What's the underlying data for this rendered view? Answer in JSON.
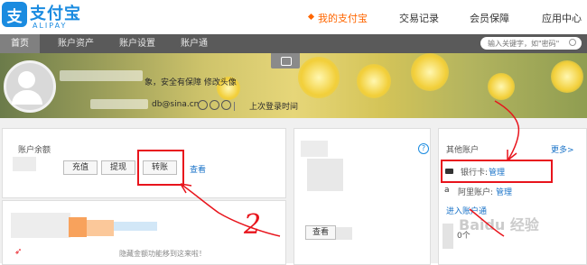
{
  "brand": {
    "logo_glyph": "支",
    "name": "支付宝",
    "sub": "ALIPAY",
    "color": "#1a8be0"
  },
  "topnav": [
    {
      "label": "我的支付宝",
      "active": true
    },
    {
      "label": "交易记录"
    },
    {
      "label": "会员保障"
    },
    {
      "label": "应用中心"
    }
  ],
  "subnav": [
    {
      "label": "首页",
      "active": true
    },
    {
      "label": "账户资产"
    },
    {
      "label": "账户设置"
    },
    {
      "label": "账户通"
    }
  ],
  "search": {
    "placeholder": "输入关键字，如\"密码\""
  },
  "profile": {
    "security_text": "象，安全有保障  修改头像",
    "email": "db@sina.cn",
    "last_login": "上次登录时间"
  },
  "balance": {
    "title": "账户余额",
    "recharge": "充值",
    "withdraw": "提现",
    "transfer": "转账",
    "view": "查看"
  },
  "middle": {
    "help": "?",
    "view": "查看"
  },
  "hint": "隐藏金额功能移到这来啦！",
  "other_accounts": {
    "title": "其他账户",
    "more": "更多>",
    "bank_label": "银行卡:",
    "bank_manage": "管理",
    "alipay_label": "阿里账户:",
    "alipay_manage": "管理",
    "enter": "进入账户通",
    "count": "0个"
  },
  "annotation": {
    "number": "2",
    "color": "#e8141c"
  },
  "watermark": "Baidu 经验"
}
